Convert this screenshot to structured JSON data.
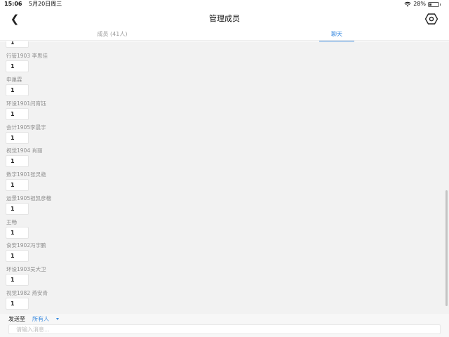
{
  "status_bar": {
    "time": "15:06",
    "date": "5月20日周三",
    "battery": "28%",
    "battery_level": 0.28
  },
  "nav": {
    "title": "管理成员"
  },
  "tabs": [
    {
      "label": "成员 (41人)",
      "active": false
    },
    {
      "label": "聊天",
      "active": true
    }
  ],
  "messages": {
    "partial_top_text": "1",
    "items": [
      {
        "sender": "行管1903 李思佳",
        "text": "1"
      },
      {
        "sender": "申巢霖",
        "text": "1"
      },
      {
        "sender": "环设1901闫育钰",
        "text": "1"
      },
      {
        "sender": "会计1905李晨宇",
        "text": "1"
      },
      {
        "sender": "视觉1904 肖丽",
        "text": "1"
      },
      {
        "sender": "数字1901张灵艳",
        "text": "1"
      },
      {
        "sender": "运景1905祖凯彦楷",
        "text": "1"
      },
      {
        "sender": "王畅",
        "text": "1"
      },
      {
        "sender": "食安1902冯宇鹏",
        "text": "1"
      },
      {
        "sender": "环设1903吴大卫",
        "text": "1"
      },
      {
        "sender": "视觉1982 燕安青",
        "text": "1"
      }
    ]
  },
  "composer": {
    "send_to_label": "发送至",
    "recipient": "所有人",
    "placeholder": "请输入消息..."
  },
  "colors": {
    "accent": "#3b8be0",
    "list_background": "#f2f2f2"
  }
}
